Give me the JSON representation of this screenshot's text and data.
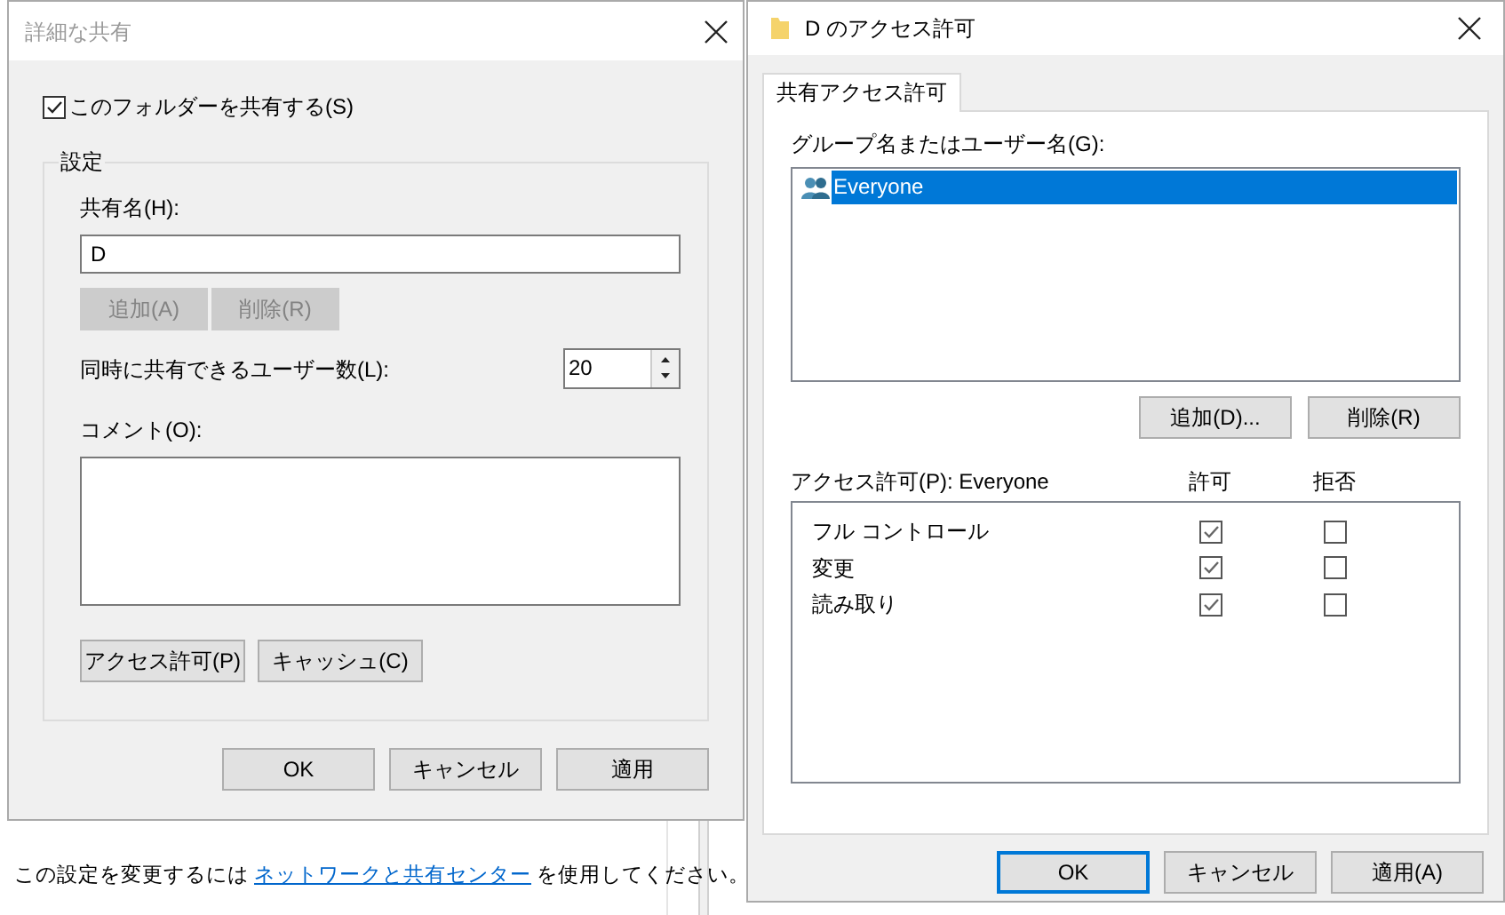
{
  "background": {
    "text_before_link": "この設定を変更するには",
    "link": "ネットワークと共有センター",
    "text_after_link": "を使用してください。"
  },
  "advanced_sharing": {
    "title": "詳細な共有",
    "share_checkbox": {
      "label": "このフォルダーを共有する(S)",
      "checked": true
    },
    "group_title": "設定",
    "share_name_label": "共有名(H):",
    "share_name_value": "D",
    "name_buttons": [
      {
        "label": "追加(A)",
        "disabled": true
      },
      {
        "label": "削除(R)",
        "disabled": true
      }
    ],
    "user_limit_label": "同時に共有できるユーザー数(L):",
    "user_limit_value": "20",
    "comment_label": "コメント(O):",
    "group_buttons": [
      "アクセス許可(P)",
      "キャッシュ(C)"
    ],
    "buttons": [
      {
        "label": "OK",
        "focused": false
      },
      {
        "label": "キャンセル",
        "focused": false
      },
      {
        "label": "適用",
        "focused": false
      }
    ]
  },
  "permissions": {
    "title": "D のアクセス許可",
    "tabs": [
      {
        "label": "共有アクセス許可",
        "selected": true
      }
    ],
    "users_label": "グループ名またはユーザー名(G):",
    "users": [
      {
        "name": "Everyone",
        "selected": true
      }
    ],
    "user_buttons": [
      "追加(D)...",
      "削除(R)"
    ],
    "permissions_label": "アクセス許可(P): Everyone",
    "columns": [
      "許可",
      "拒否"
    ],
    "rows": [
      {
        "name": "フル コントロール",
        "allow": true,
        "deny": false
      },
      {
        "name": "変更",
        "allow": true,
        "deny": false
      },
      {
        "name": "読み取り",
        "allow": true,
        "deny": false
      }
    ],
    "buttons": [
      {
        "label": "OK",
        "focused": true
      },
      {
        "label": "キャンセル",
        "focused": false
      },
      {
        "label": "適用(A)",
        "focused": false
      }
    ]
  }
}
